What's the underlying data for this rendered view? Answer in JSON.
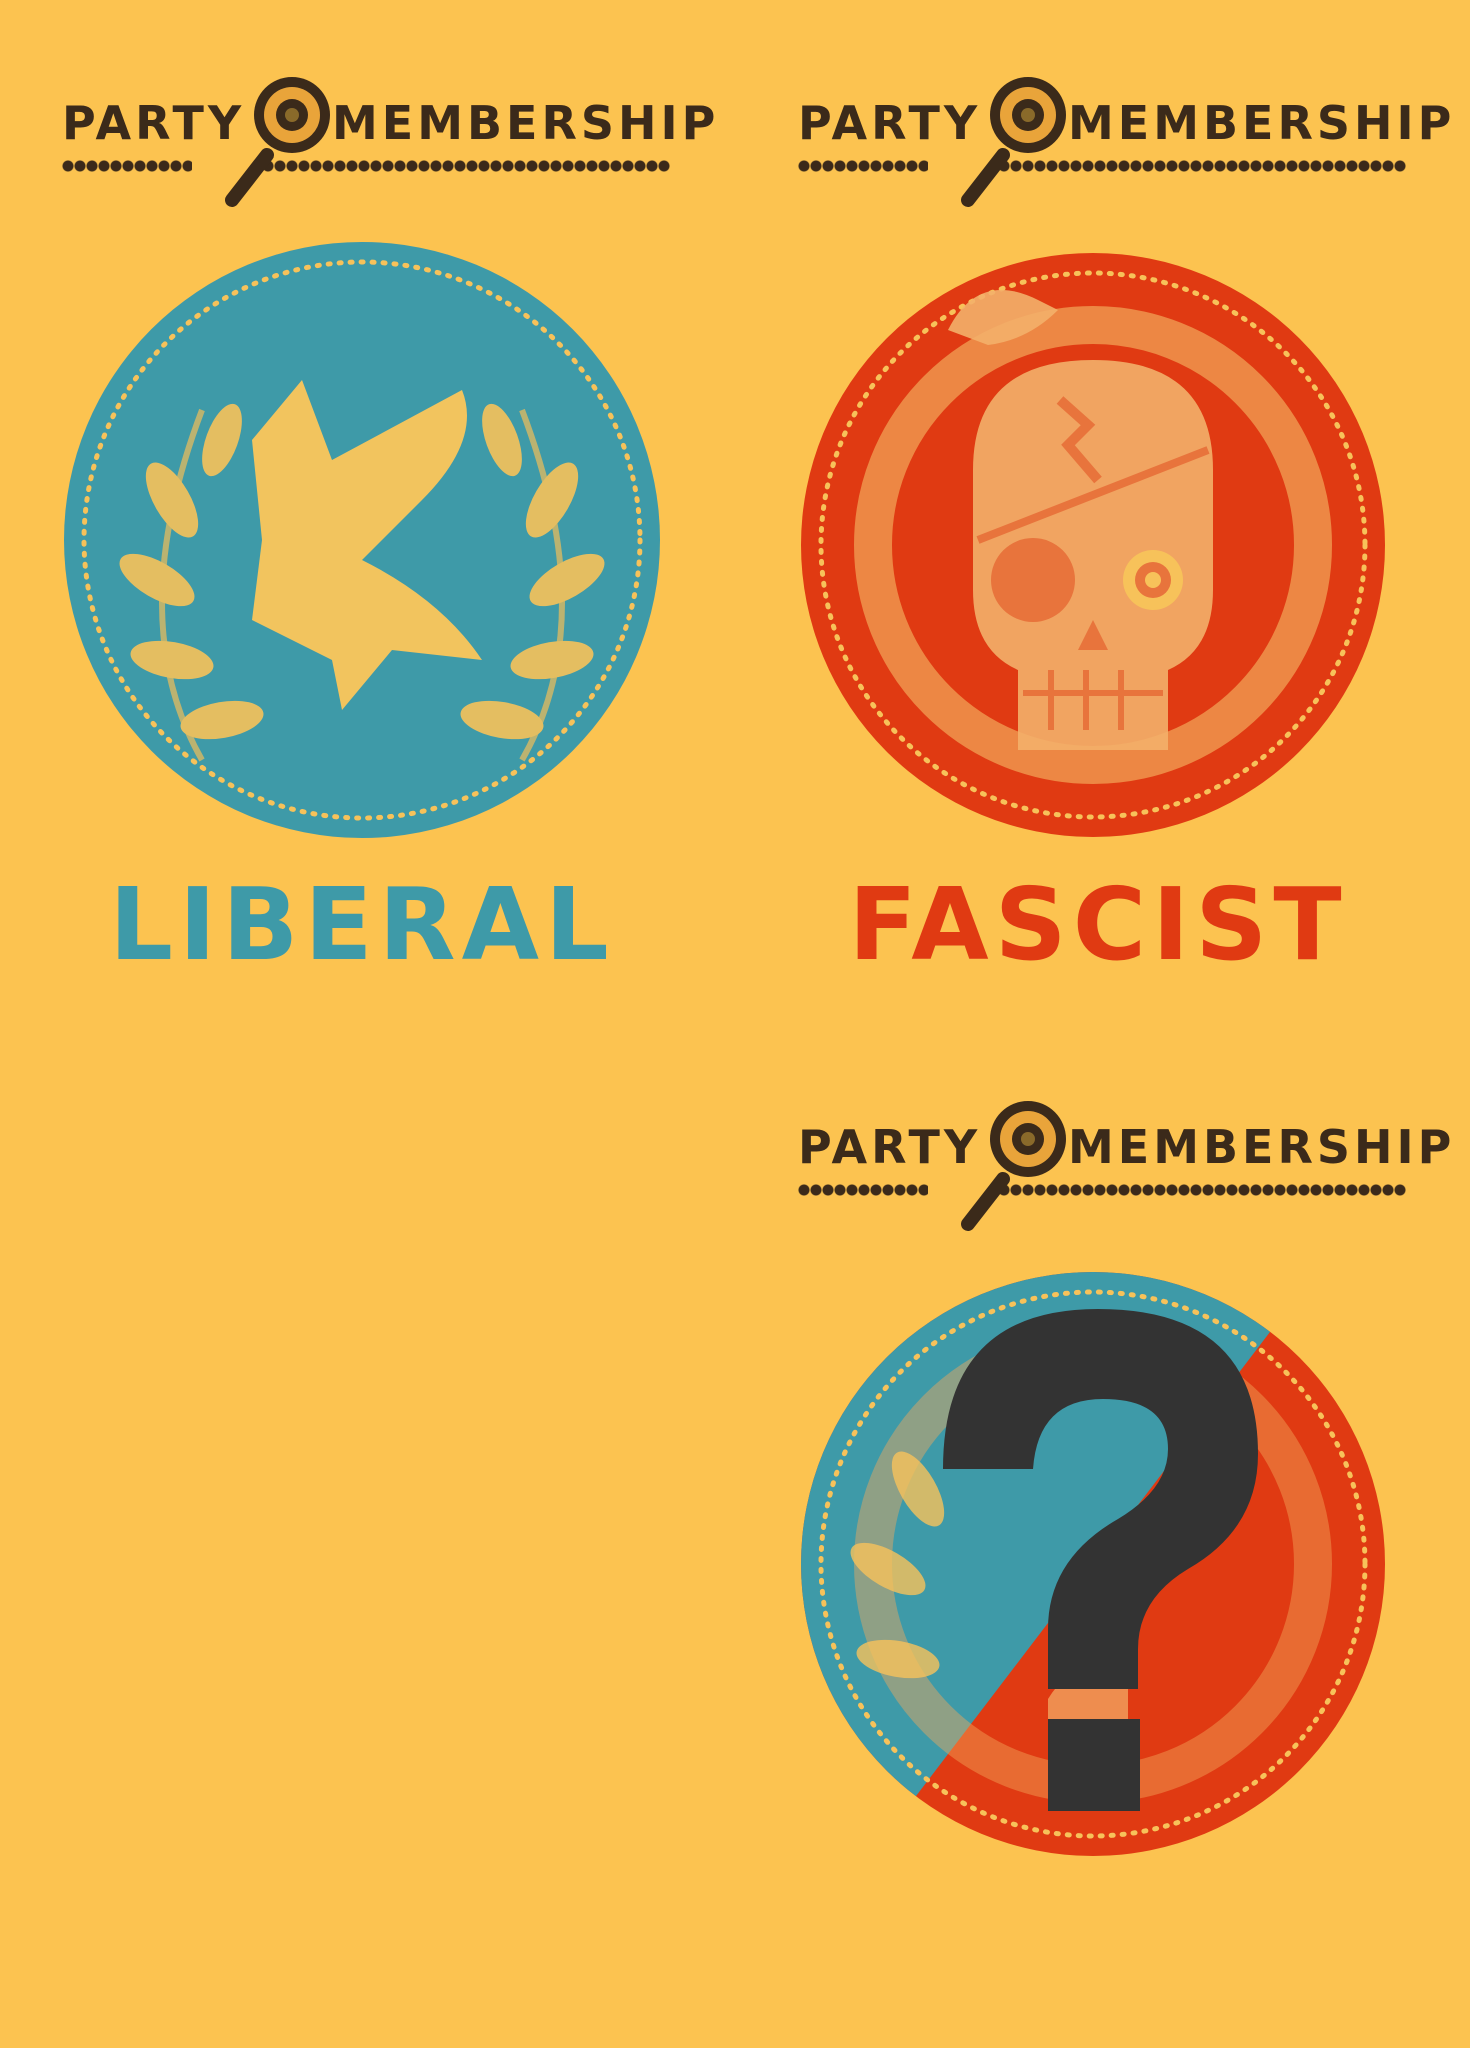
{
  "cards": [
    {
      "header_left": "PARTY",
      "header_right": "MEMBERSHIP",
      "label": "LIBERAL",
      "label_color": "#3E9AA8",
      "seal_color": "#3E9AA8",
      "emblem_icon": "dove-laurel-icon"
    },
    {
      "header_left": "PARTY",
      "header_right": "MEMBERSHIP",
      "label": "FASCIST",
      "label_color": "#E03A12",
      "seal_color": "#E03A12",
      "emblem_icon": "skull-snake-icon"
    },
    {
      "header_left": "PARTY",
      "header_right": "MEMBERSHIP",
      "label": "",
      "emblem_icon": "question-mark-icon"
    }
  ],
  "colors": {
    "background": "#FCC350",
    "ink": "#3B2A1A",
    "liberal": "#3E9AA8",
    "fascist": "#E03A12",
    "emblem": "#F7C25A",
    "question": "#333333"
  }
}
